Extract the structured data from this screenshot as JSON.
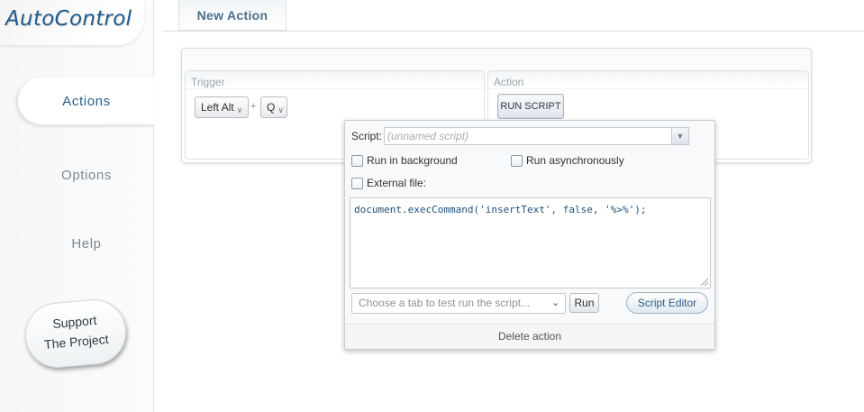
{
  "app": {
    "logo": "AutoControl"
  },
  "sidebar": {
    "items": [
      {
        "label": "Actions"
      },
      {
        "label": "Options"
      },
      {
        "label": "Help"
      }
    ],
    "support": {
      "line1": "Support",
      "line2": "The Project"
    }
  },
  "header": {
    "tab": "New Action"
  },
  "trigger": {
    "title": "Trigger",
    "modifier": "Left Alt",
    "plus": "+",
    "key": "Q"
  },
  "action": {
    "title": "Action",
    "type_button": "RUN SCRIPT"
  },
  "script_popup": {
    "script_label": "Script:",
    "script_placeholder": "(unnamed script)",
    "run_in_background": "Run in background",
    "run_asynchronously": "Run asynchronously",
    "external_file": "External file:",
    "code": "document.execCommand('insertText', false, '%>%');",
    "tab_select_placeholder": "Choose a tab to test run the script...",
    "run_label": "Run",
    "script_editor_label": "Script Editor",
    "delete_label": "Delete action"
  },
  "icons": {
    "dropdown": "chevron-down-icon",
    "resize": "resize-grip-icon"
  },
  "colors": {
    "accent": "#1e5a8c",
    "active_nav": "#2a5f86"
  }
}
